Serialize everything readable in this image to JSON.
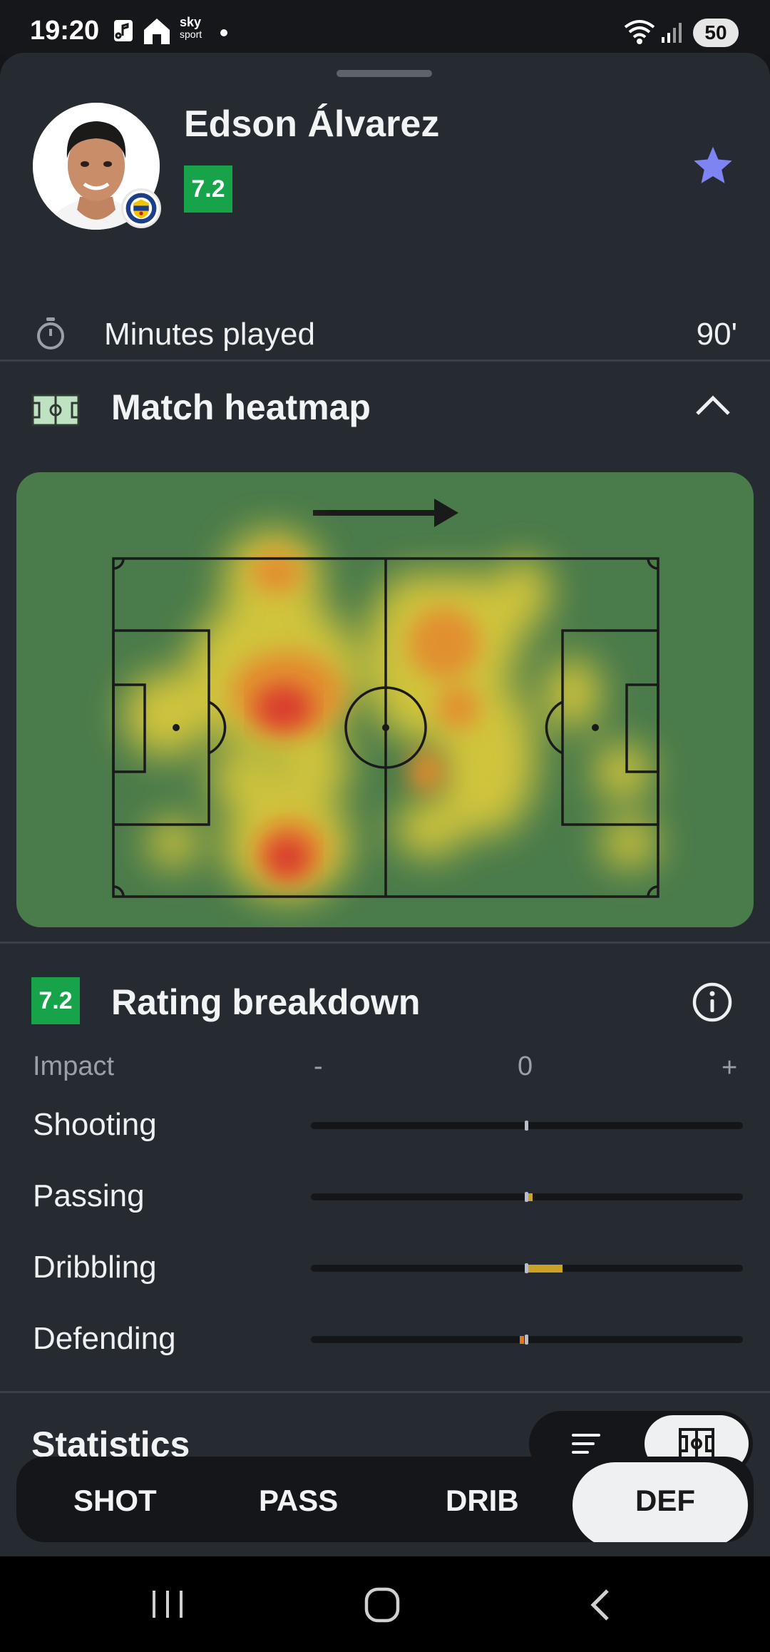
{
  "status_bar": {
    "time": "19:20",
    "app_icons": [
      "music-app-icon",
      "home-app-icon",
      "sky-sport-icon",
      "notification-dot-icon"
    ],
    "sky_label": "sky",
    "sport_label": "sport",
    "right_icons": [
      "wifi-icon",
      "signal-icon"
    ],
    "battery": "50"
  },
  "player": {
    "name": "Edson Álvarez",
    "rating": "7.2",
    "favorite_color": "#7f84f5"
  },
  "minutes": {
    "label": "Minutes played",
    "value": "90'"
  },
  "heatmap": {
    "title": "Match heatmap",
    "pitch_color": "#4a7b4b"
  },
  "rating_breakdown": {
    "badge": "7.2",
    "title": "Rating breakdown",
    "impact_label": "Impact",
    "minus": "-",
    "zero": "0",
    "plus": "+",
    "stats": [
      {
        "label": "Shooting",
        "impact": 0.0,
        "color": "#c9a227"
      },
      {
        "label": "Passing",
        "impact": 0.02,
        "color": "#c9a227"
      },
      {
        "label": "Dribbling",
        "impact": 0.16,
        "color": "#c9a227"
      },
      {
        "label": "Defending",
        "impact": -0.02,
        "color": "#e07b1f"
      }
    ]
  },
  "statistics": {
    "title": "Statistics",
    "tabs": [
      "SHOT",
      "PASS",
      "DRIB",
      "DEF"
    ],
    "active_tab": "DEF"
  },
  "colors": {
    "rating_green": "#16a34a",
    "background": "#262a31"
  }
}
